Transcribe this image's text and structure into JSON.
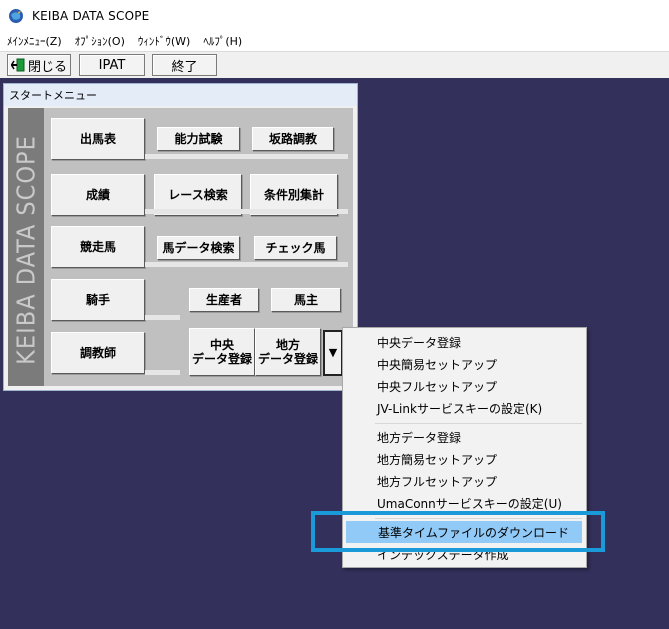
{
  "window": {
    "title": "KEIBA DATA SCOPE"
  },
  "menubar": {
    "items": [
      "ﾒｲﾝﾒﾆｭｰ(Z)",
      "ｵﾌﾟｼｮﾝ(O)",
      "ｳｨﾝﾄﾞｳ(W)",
      "ﾍﾙﾌﾟ(H)"
    ]
  },
  "toolbar": {
    "close_label": "閉じる",
    "ipat_label": "IPAT",
    "exit_label": "終了"
  },
  "start_menu": {
    "title": "スタートメニュー",
    "side_label": "KEIBA DATA SCOPE",
    "buttons": {
      "shutuba": "出馬表",
      "nouryoku": "能力試験",
      "hanro": "坂路調教",
      "seiseki": "成績",
      "race_search": "レース検索",
      "jouken": "条件別集計",
      "kyousouba": "競走馬",
      "uma_search": "馬データ検索",
      "check_uma": "チェック馬",
      "kishu": "騎手",
      "seisansha": "生産者",
      "banushi": "馬主",
      "choukyoushi": "調教師",
      "chuou_line1": "中央",
      "chuou_line2": "データ登録",
      "chihou_line1": "地方",
      "chihou_line2": "データ登録",
      "dropdown_arrow": "▼"
    }
  },
  "dropdown": {
    "items": [
      "中央データ登録",
      "中央簡易セットアップ",
      "中央フルセットアップ",
      "JV-Linkサービスキーの設定(K)",
      "地方データ登録",
      "地方簡易セットアップ",
      "地方フルセットアップ",
      "UmaConnサービスキーの設定(U)",
      "基準タイムファイルのダウンロード",
      "インデックスデータ作成"
    ],
    "highlighted_index": 8
  },
  "colors": {
    "mdi_background": "#34305c",
    "highlight_fill": "#91c9f7",
    "annotation_border": "#1a9ad9"
  }
}
